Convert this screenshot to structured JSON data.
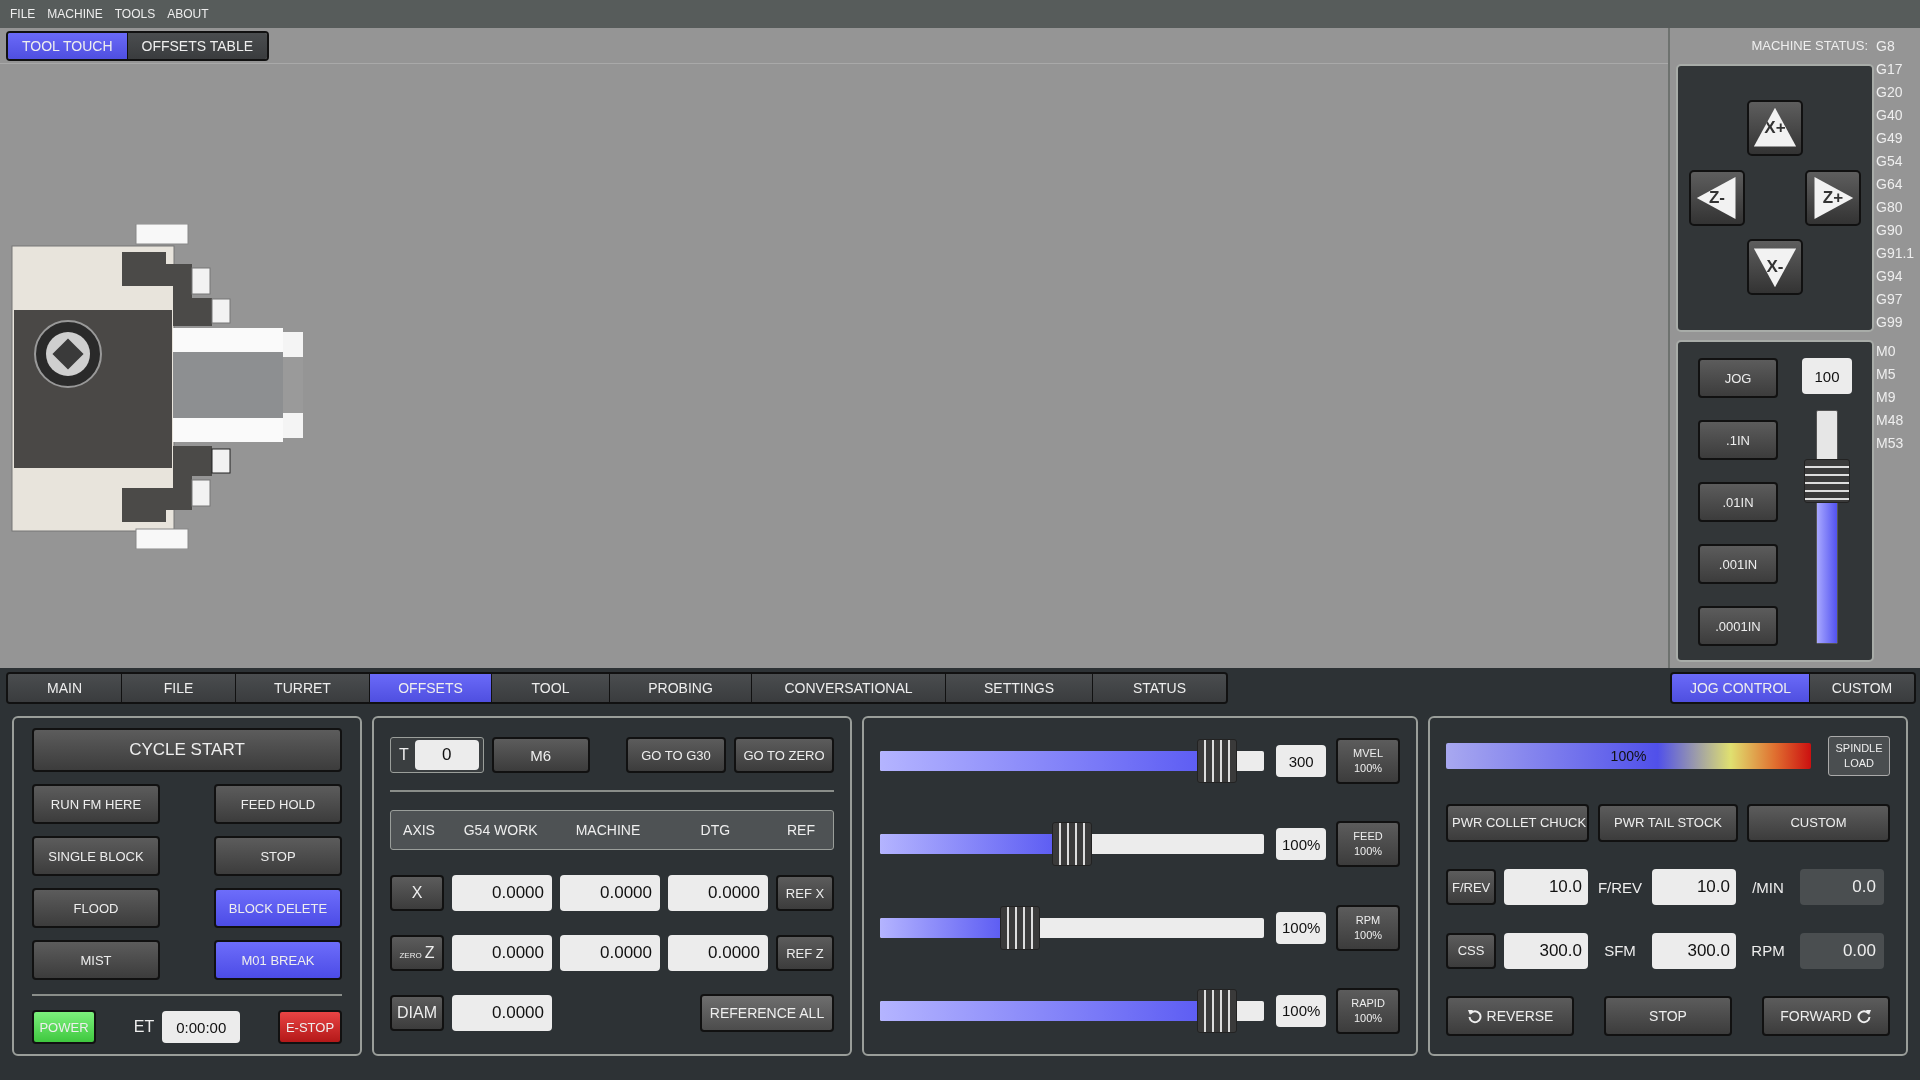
{
  "menu": [
    "FILE",
    "MACHINE",
    "TOOLS",
    "ABOUT"
  ],
  "view_tabs": [
    {
      "label": "TOOL TOUCH",
      "selected": true
    },
    {
      "label": "OFFSETS TABLE",
      "selected": false
    }
  ],
  "machine_status": {
    "label": "MACHINE STATUS:",
    "g_codes": [
      "G8",
      "G17",
      "G20",
      "G40",
      "G49",
      "G54",
      "G64",
      "G80",
      "G90",
      "G91.1",
      "G94",
      "G97",
      "G99"
    ],
    "m_codes": [
      "M0",
      "M5",
      "M9",
      "M48",
      "M53"
    ]
  },
  "jog_buttons": [
    {
      "label": "X+",
      "kind": "up"
    },
    {
      "label": "Z-",
      "kind": "left"
    },
    {
      "label": "Z+",
      "kind": "right"
    },
    {
      "label": "X-",
      "kind": "down"
    }
  ],
  "jog_steps": [
    "JOG",
    ".1IN",
    ".01IN",
    ".001IN",
    ".0001IN"
  ],
  "jog_rate": {
    "value": "100",
    "level": 0.74
  },
  "main_tabs": [
    {
      "label": "MAIN",
      "selected": false
    },
    {
      "label": "FILE",
      "selected": false
    },
    {
      "label": "TURRET",
      "selected": false
    },
    {
      "label": "OFFSETS",
      "selected": true
    },
    {
      "label": "TOOL",
      "selected": false
    },
    {
      "label": "PROBING",
      "selected": false
    },
    {
      "label": "CONVERSATIONAL",
      "selected": false
    },
    {
      "label": "SETTINGS",
      "selected": false
    },
    {
      "label": "STATUS",
      "selected": false
    }
  ],
  "side_tabs": [
    {
      "label": "JOG CONTROL",
      "selected": true
    },
    {
      "label": "CUSTOM",
      "selected": false
    }
  ],
  "program": {
    "cycle_start": "CYCLE START",
    "buttons": [
      {
        "label": "RUN FM HERE",
        "on": false
      },
      {
        "label": "FEED HOLD",
        "on": false
      },
      {
        "label": "SINGLE BLOCK",
        "on": false
      },
      {
        "label": "STOP",
        "on": false
      },
      {
        "label": "FLOOD",
        "on": false
      },
      {
        "label": "BLOCK DELETE",
        "on": true
      },
      {
        "label": "MIST",
        "on": false
      },
      {
        "label": "M01 BREAK",
        "on": true
      }
    ],
    "power": {
      "label": "POWER",
      "on": true
    },
    "et_label": "ET",
    "et_value": "0:00:00",
    "estop": "E-STOP"
  },
  "offsets": {
    "tool_label": "T",
    "tool_value": "0",
    "m6": "M6",
    "go_buttons": [
      "GO TO G30",
      "GO TO ZERO"
    ],
    "columns": [
      "AXIS",
      "G54 WORK",
      "MACHINE",
      "DTG",
      "REF"
    ],
    "rows": [
      {
        "axis": "X",
        "work": "0.0000",
        "machine": "0.0000",
        "dtg": "0.0000",
        "ref": "REF X"
      },
      {
        "prefix": "ZERO",
        "axis": "Z",
        "work": "0.0000",
        "machine": "0.0000",
        "dtg": "0.0000",
        "ref": "REF Z"
      }
    ],
    "diam": {
      "label": "DIAM",
      "value": "0.0000"
    },
    "reference_all": "REFERENCE ALL"
  },
  "overrides": [
    {
      "value": "300",
      "name": "MVEL",
      "percent": "100%",
      "level": 0.92
    },
    {
      "value": "100%",
      "name": "FEED",
      "percent": "100%",
      "level": 0.5
    },
    {
      "value": "100%",
      "name": "RPM",
      "percent": "100%",
      "level": 0.35
    },
    {
      "value": "100%",
      "name": "RAPID",
      "percent": "100%",
      "level": 0.92
    }
  ],
  "spindle": {
    "load_reading": "100%",
    "load_label": "SPINDLE LOAD",
    "buttons": [
      "PWR COLLET CHUCK",
      "PWR TAIL STOCK",
      "CUSTOM"
    ],
    "rows": [
      {
        "mode": "F/REV",
        "value": "10.0",
        "unit": "F/REV",
        "value2": "10.0",
        "unit2": "/MIN",
        "readout": "0.0"
      },
      {
        "mode": "CSS",
        "value": "300.0",
        "unit": "SFM",
        "value2": "300.0",
        "unit2": "RPM",
        "readout": "0.00"
      }
    ],
    "direction": [
      {
        "label": "REVERSE",
        "kind": "reverse"
      },
      {
        "label": "STOP",
        "kind": "stop"
      },
      {
        "label": "FORWARD",
        "kind": "forward"
      }
    ]
  }
}
